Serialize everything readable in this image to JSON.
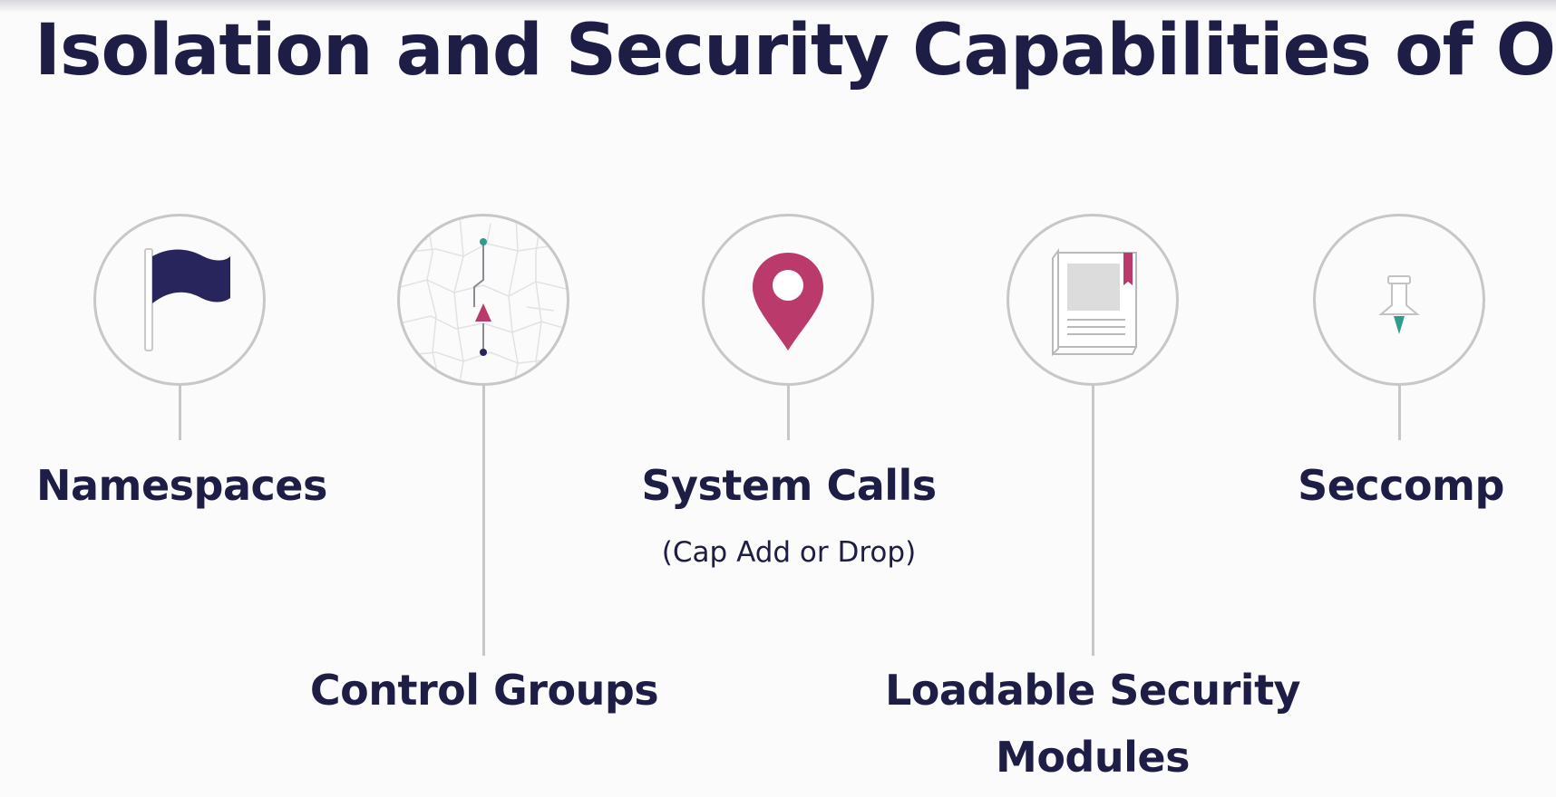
{
  "slide": {
    "title": "Isolation and Security Capabilities of OS"
  },
  "items": [
    {
      "label": "Namespaces",
      "icon": "flag-icon"
    },
    {
      "label": "Control Groups",
      "icon": "map-route-icon"
    },
    {
      "label": "System Calls",
      "sublabel": "(Cap Add or Drop)",
      "icon": "location-pin-icon"
    },
    {
      "label": "Loadable Security",
      "label_line2": "Modules",
      "icon": "book-icon"
    },
    {
      "label": "Seccomp",
      "icon": "pushpin-icon"
    }
  ],
  "colors": {
    "navy": "#1d1d45",
    "magenta": "#b93a6b",
    "teal": "#2f9c8c",
    "circle_stroke": "#c7c7c7"
  }
}
